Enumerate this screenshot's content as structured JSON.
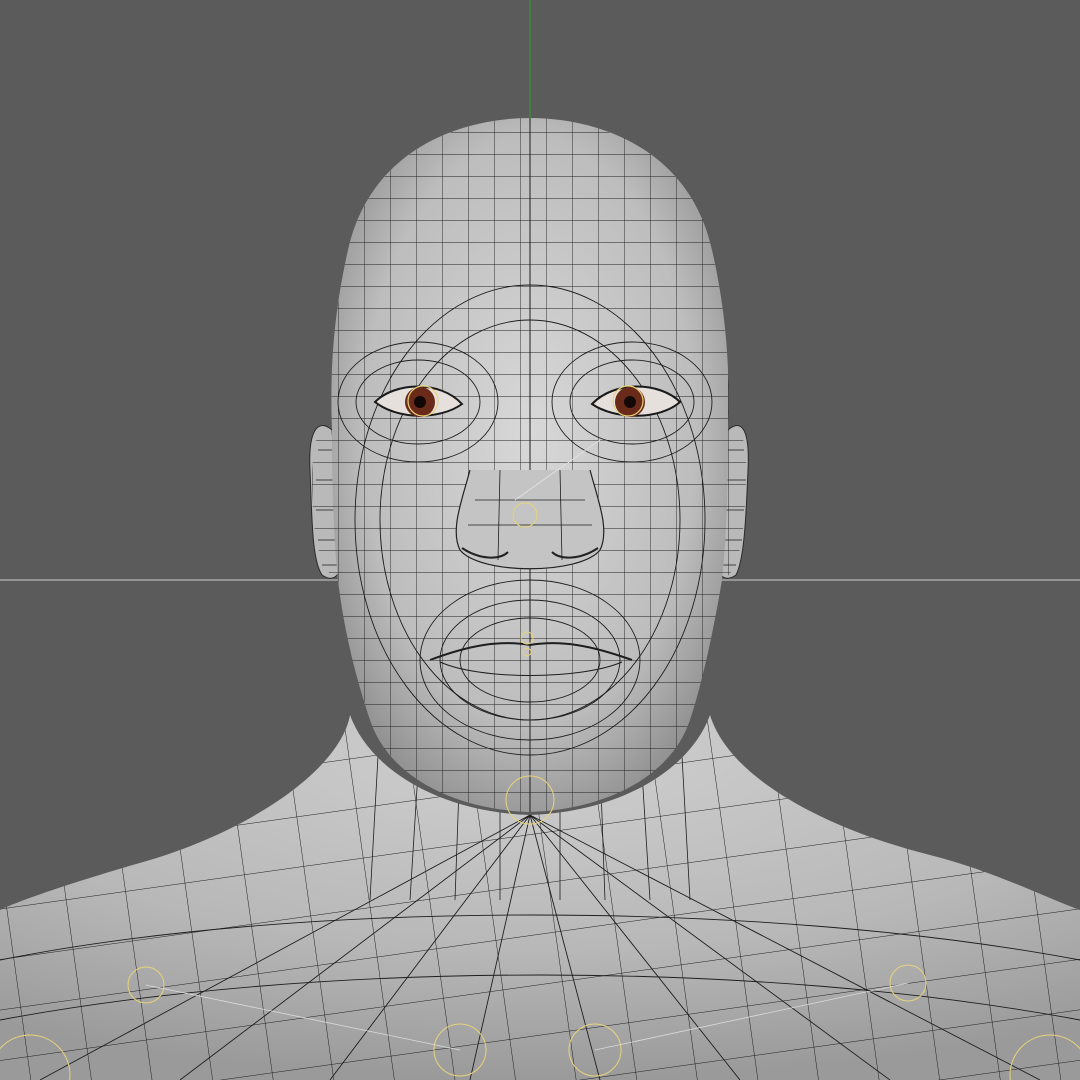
{
  "viewport": {
    "background_color": "#5b5b5b",
    "mesh_fill_color": "#c8c8c8",
    "wire_color": "#1e1e1e",
    "x_axis_color": "#cfcfcf",
    "y_axis_color": "#2f9a2f",
    "joint_helper_color": "#e8d47a",
    "iris_color": "#6a2a1a"
  },
  "scene": {
    "object": "head-and-shoulders-mesh",
    "shading": "wireframe-on-shaded",
    "view": "front"
  }
}
